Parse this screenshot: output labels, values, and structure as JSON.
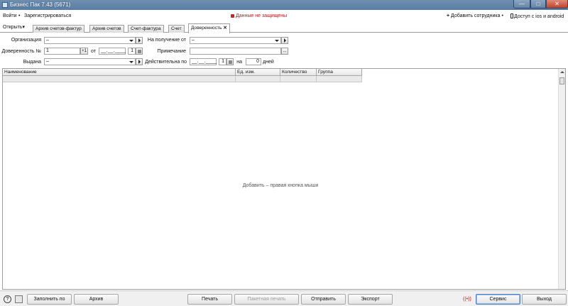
{
  "window": {
    "title": "Бизнес Пак 7.43 (5671)",
    "minimize": "—",
    "maximize": "□",
    "close": "✕"
  },
  "menu": {
    "login": "Войти",
    "sep": "•",
    "register": "Зарегистрироваться",
    "warning": "Данные не защищены",
    "add_employee": "Добавить сотрудника",
    "mobile_access": "Доступ с ios и android"
  },
  "tabs": {
    "open": "Открыть",
    "items": [
      {
        "label": "Архив счетов-фактур"
      },
      {
        "label": "Архив счетов"
      },
      {
        "label": "Счет-фактура"
      },
      {
        "label": "Счет"
      },
      {
        "label": "Доверенность",
        "active": true
      }
    ],
    "close_glyph": "✕"
  },
  "form": {
    "org_label": "Организация",
    "org_value": "–",
    "recv_label": "На получение от",
    "recv_value": "–",
    "poa_label": "Доверенность №",
    "poa_number": "1",
    "poa_plus": "+1",
    "from_label": "от",
    "from_date": "__.__.____",
    "from_day": "1",
    "note_label": "Примечание",
    "note_value": "",
    "note_btn": "...",
    "issued_label": "Выдана",
    "issued_value": "–",
    "valid_label": "Действительна по",
    "valid_date": "__.__.____",
    "valid_day": "1",
    "on_label": "на",
    "days_value": "0",
    "days_label": "дней"
  },
  "grid": {
    "columns": [
      "Наименование",
      "Ед. изм.",
      "Количество",
      "Группа"
    ],
    "hint": "Добавить – правая кнопка мыши"
  },
  "bottom": {
    "help": "?",
    "fill": "Заполнить по",
    "archive": "Архив",
    "print": "Печать",
    "batch_print": "Пакетная печать",
    "send": "Отправить",
    "export": "Экспорт",
    "radio": "((•))",
    "service": "Сервис",
    "exit": "Выход"
  }
}
